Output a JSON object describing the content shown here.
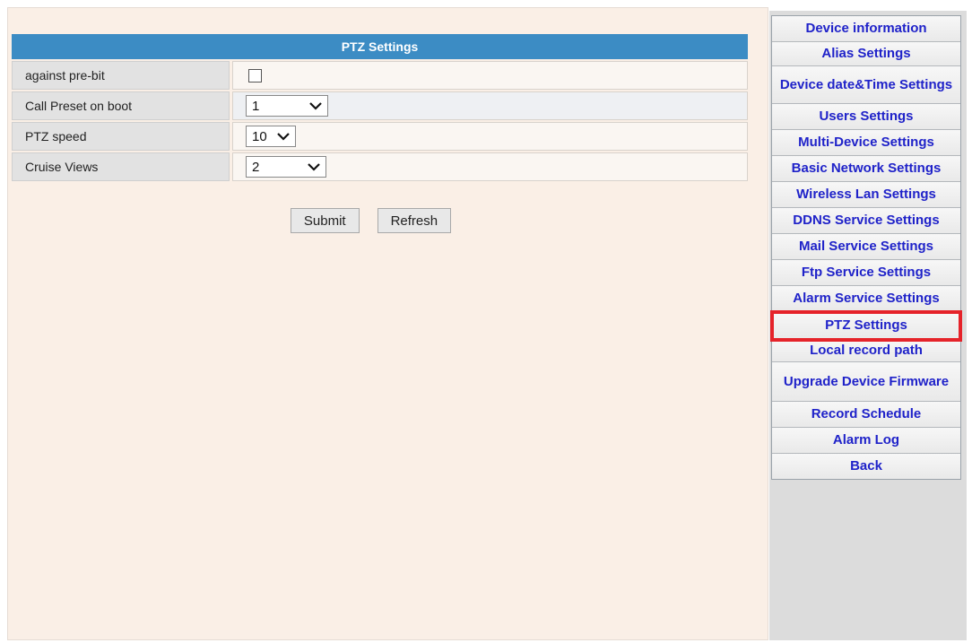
{
  "main": {
    "table_title": "PTZ Settings",
    "rows": [
      {
        "label": "against pre-bit",
        "type": "checkbox",
        "checked": false
      },
      {
        "label": "Call Preset on boot",
        "type": "select",
        "value": "1"
      },
      {
        "label": "PTZ speed",
        "type": "select",
        "value": "10"
      },
      {
        "label": "Cruise Views",
        "type": "select",
        "value": "2"
      }
    ],
    "submit_label": "Submit",
    "refresh_label": "Refresh"
  },
  "sidebar": {
    "items": [
      {
        "label": "Device information"
      },
      {
        "label": "Alias Settings"
      },
      {
        "label": "Device date&Time Settings"
      },
      {
        "label": "Users Settings"
      },
      {
        "label": "Multi-Device Settings"
      },
      {
        "label": "Basic Network Settings"
      },
      {
        "label": "Wireless Lan Settings"
      },
      {
        "label": "DDNS Service Settings"
      },
      {
        "label": "Mail Service Settings"
      },
      {
        "label": "Ftp Service Settings"
      },
      {
        "label": "Alarm Service Settings"
      },
      {
        "label": "PTZ Settings",
        "active": true
      },
      {
        "label": "Local record path"
      },
      {
        "label": "Upgrade Device Firmware"
      },
      {
        "label": "Record Schedule"
      },
      {
        "label": "Alarm Log"
      },
      {
        "label": "Back"
      }
    ],
    "active_highlight_color": "#e5232a",
    "link_color": "#1f22c9"
  },
  "colors": {
    "header": "#3c8cc4",
    "page_background": "#faefe6"
  }
}
